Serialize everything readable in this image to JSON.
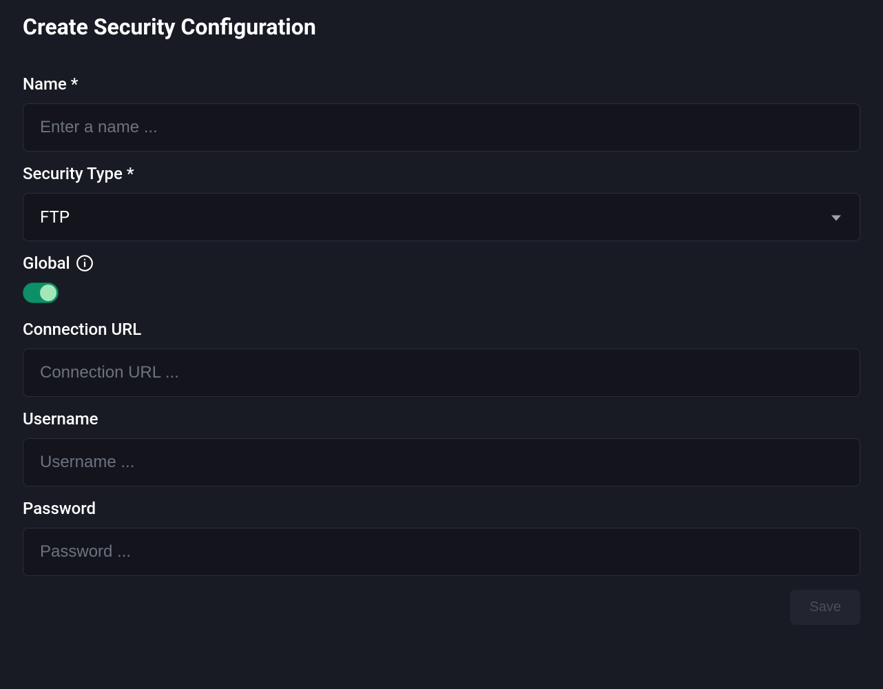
{
  "page": {
    "title": "Create Security Configuration"
  },
  "fields": {
    "name": {
      "label": "Name *",
      "placeholder": "Enter a name ...",
      "value": ""
    },
    "security_type": {
      "label": "Security Type *",
      "selected": "FTP"
    },
    "global": {
      "label": "Global",
      "enabled": true
    },
    "connection_url": {
      "label": "Connection URL",
      "placeholder": "Connection URL ...",
      "value": ""
    },
    "username": {
      "label": "Username",
      "placeholder": "Username ...",
      "value": ""
    },
    "password": {
      "label": "Password",
      "placeholder": "Password ...",
      "value": ""
    }
  },
  "buttons": {
    "save": "Save"
  }
}
